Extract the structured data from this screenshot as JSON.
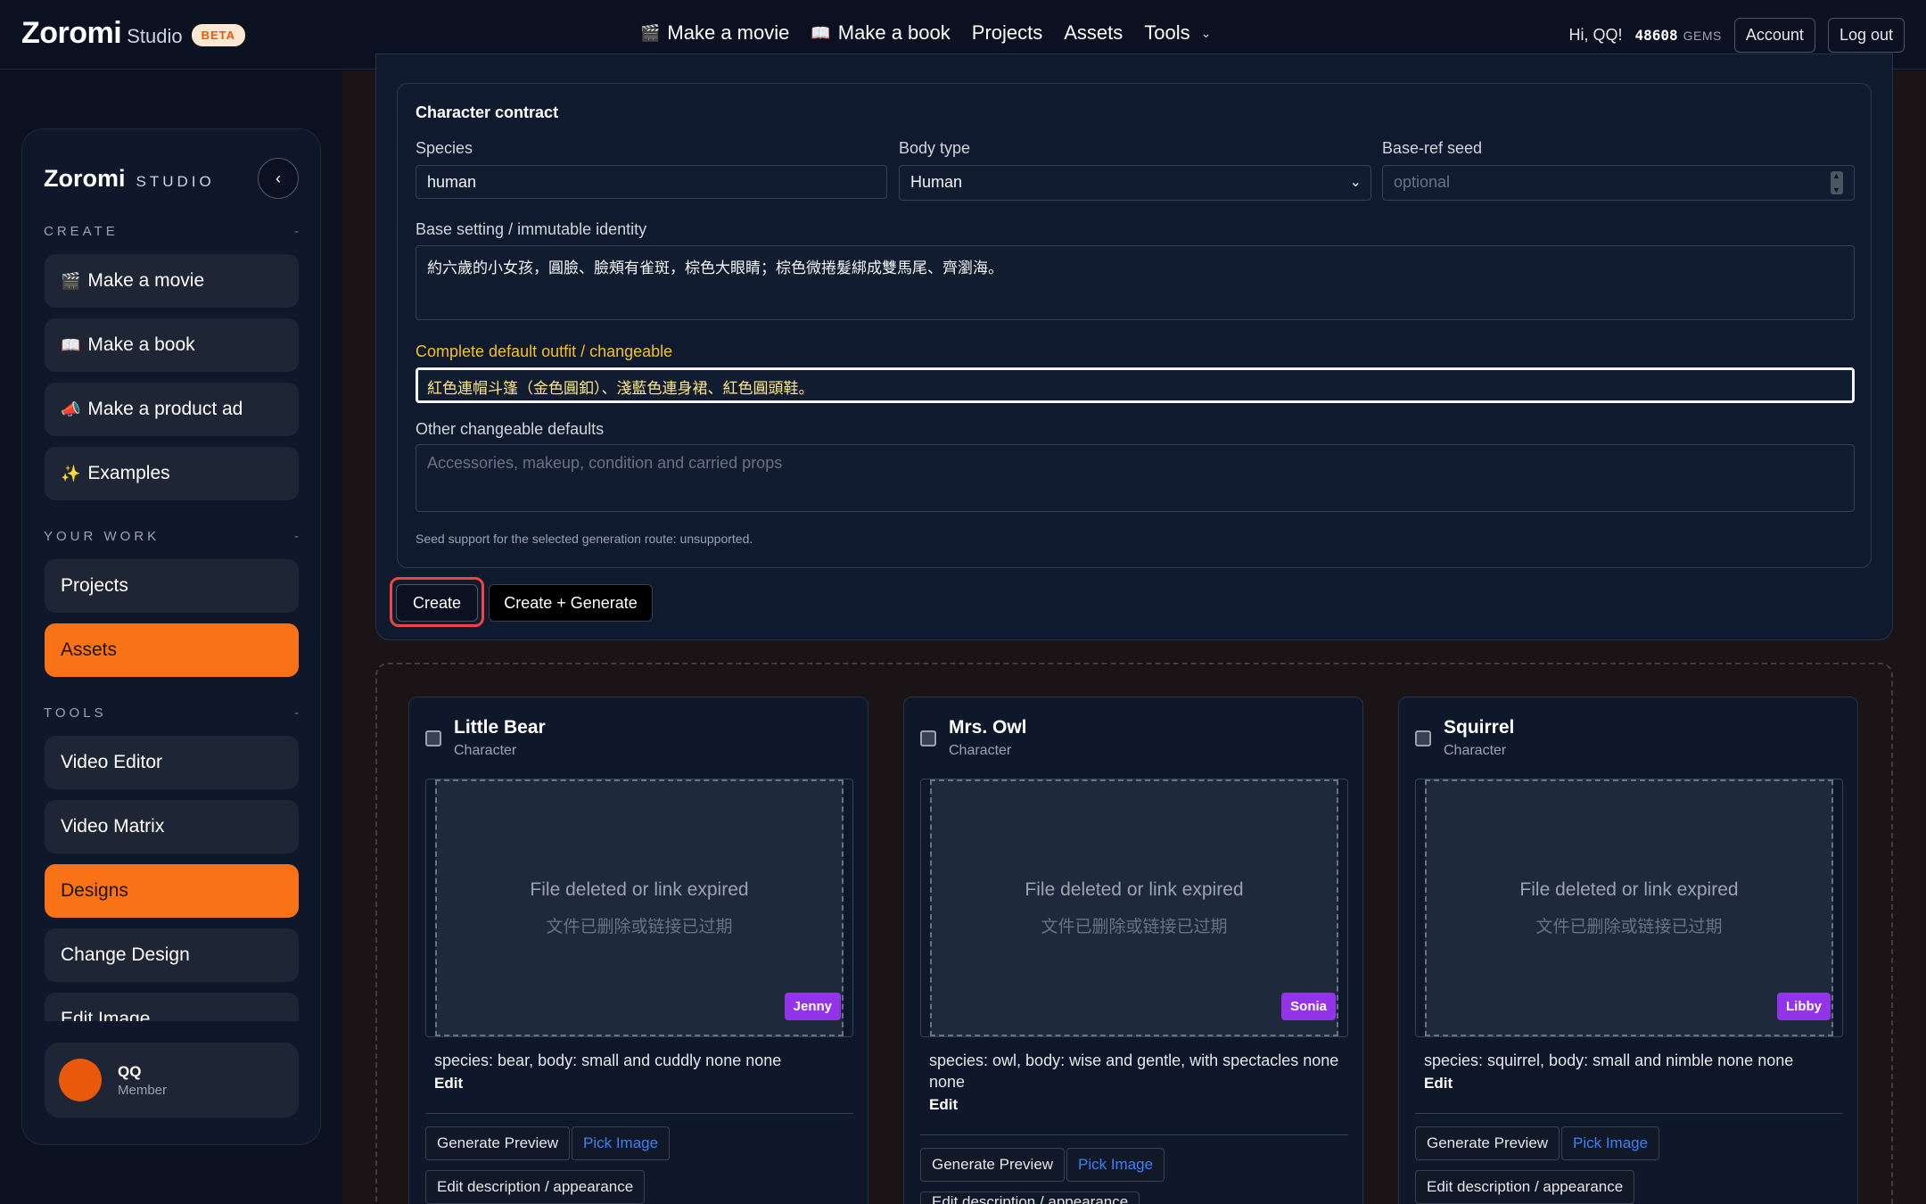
{
  "header": {
    "brand": "Zoromi",
    "brand_sub": "Studio",
    "beta": "BETA",
    "nav": [
      {
        "emoji": "🎬",
        "label": "Make a movie"
      },
      {
        "emoji": "📖",
        "label": "Make a book"
      },
      {
        "label": "Projects"
      },
      {
        "label": "Assets"
      },
      {
        "label": "Tools"
      }
    ],
    "greeting": "Hi, QQ!",
    "gems_value": "48608",
    "gems_unit": "GEMS",
    "account": "Account",
    "logout": "Log out"
  },
  "sidebar": {
    "brand": "Zoromi",
    "brand_sub": "STUDIO",
    "sections": {
      "create": "CREATE",
      "your_work": "YOUR WORK",
      "tools": "TOOLS"
    },
    "collapse_marker": "-",
    "create_items": [
      {
        "emoji": "🎬",
        "label": "Make a movie"
      },
      {
        "emoji": "📖",
        "label": "Make a book"
      },
      {
        "emoji": "📣",
        "label": "Make a product ad"
      },
      {
        "emoji": "✨",
        "label": "Examples"
      }
    ],
    "work_items": [
      {
        "label": "Projects",
        "active": false
      },
      {
        "label": "Assets",
        "active": true
      }
    ],
    "tool_items": [
      {
        "label": "Video Editor",
        "active": false
      },
      {
        "label": "Video Matrix",
        "active": false
      },
      {
        "label": "Designs",
        "active": true
      },
      {
        "label": "Change Design",
        "active": false
      },
      {
        "label": "Edit Image",
        "active": false
      }
    ],
    "user": {
      "name": "QQ",
      "role": "Member"
    }
  },
  "contract": {
    "title": "Character contract",
    "species_label": "Species",
    "species_value": "human",
    "body_label": "Body type",
    "body_value": "Human",
    "seed_label": "Base-ref seed",
    "seed_placeholder": "optional",
    "base_label": "Base setting / immutable identity",
    "base_value": "約六歲的小女孩，圓臉、臉頰有雀斑，棕色大眼睛；棕色微捲髮綁成雙馬尾、齊瀏海。",
    "outfit_label": "Complete default outfit / changeable",
    "outfit_value": "紅色連帽斗篷（金色圓釦）、淺藍色連身裙、紅色圓頭鞋。",
    "other_label": "Other changeable defaults",
    "other_placeholder": "Accessories, makeup, condition and carried props",
    "seed_note": "Seed support for the selected generation route: unsupported."
  },
  "actions": {
    "create": "Create",
    "create_generate": "Create + Generate"
  },
  "cards": [
    {
      "name": "Little Bear",
      "type": "Character",
      "missing_en": "File deleted or link expired",
      "missing_zh": "文件已删除或链接已过期",
      "voice": "Jenny",
      "desc": "species: bear, body: small and cuddly none none",
      "edit": "Edit",
      "btn_preview": "Generate Preview",
      "btn_pick": "Pick Image",
      "btn_edit_desc": "Edit description / appearance"
    },
    {
      "name": "Mrs. Owl",
      "type": "Character",
      "missing_en": "File deleted or link expired",
      "missing_zh": "文件已删除或链接已过期",
      "voice": "Sonia",
      "desc": "species: owl, body: wise and gentle, with spectacles none none",
      "edit": "Edit",
      "btn_preview": "Generate Preview",
      "btn_pick": "Pick Image",
      "btn_edit_desc": "Edit description / appearance"
    },
    {
      "name": "Squirrel",
      "type": "Character",
      "missing_en": "File deleted or link expired",
      "missing_zh": "文件已删除或链接已过期",
      "voice": "Libby",
      "desc": "species: squirrel, body: small and nimble none none",
      "edit": "Edit",
      "btn_preview": "Generate Preview",
      "btn_pick": "Pick Image",
      "btn_edit_desc": "Edit description / appearance"
    }
  ],
  "colors": {
    "accent": "#f97316",
    "voice_tag": "#9333ea",
    "highlight_label": "#fbbf24",
    "link": "#3b82f6",
    "focus_ring": "#ef4444"
  },
  "icons": {
    "collapse": "chevron-left-icon",
    "tools_menu": "chevron-down-icon",
    "select": "chevron-down-icon"
  }
}
